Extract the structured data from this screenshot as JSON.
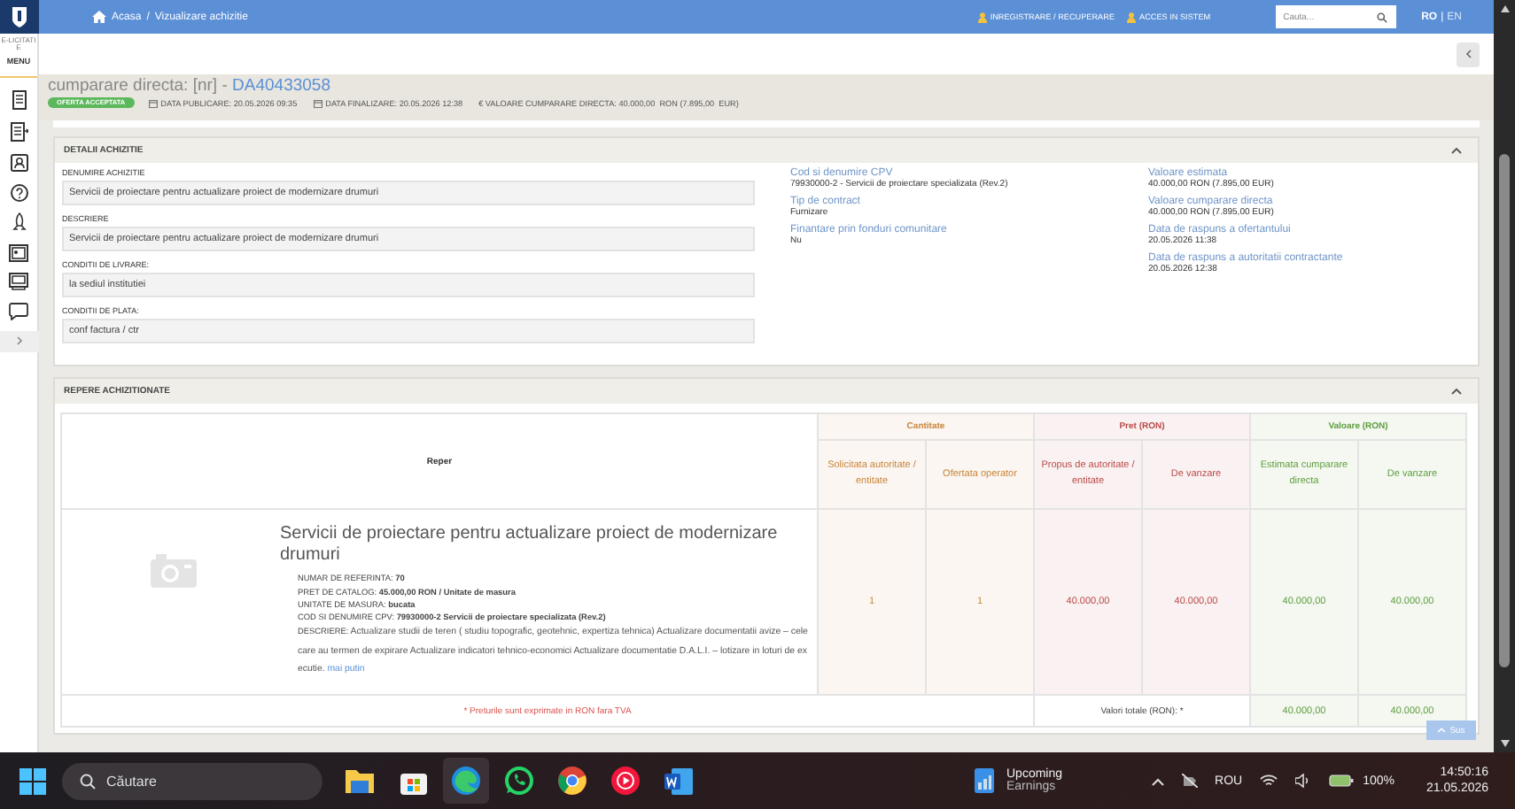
{
  "topbar": {
    "breadcrumb": [
      "Acasa",
      "Vizualizare achizitie"
    ],
    "breadcrumb_separator": "/",
    "links": [
      "INREGISTRARE / RECUPERARE",
      "ACCES IN SISTEM"
    ],
    "search": {
      "placeholder": "Cauta..."
    },
    "languages": [
      {
        "label": "RO",
        "selected": true
      },
      {
        "label": "EN",
        "selected": false
      }
    ],
    "language_separator": "|"
  },
  "sidebar": {
    "brand": "E-LICITATIE",
    "menu": "MENU"
  },
  "header": {
    "title": "cumparare directa: [nr] - ",
    "id": "DA40433058",
    "status": "OFERTA ACCEPTATA",
    "meta": [
      "DATA PUBLICARE: 20.05.2026 09:35",
      "DATA FINALIZARE: 20.05.2026 12:38",
      "€ VALOARE CUMPARARE DIRECTA: 40.000,00  RON (7.895,00  EUR)"
    ]
  },
  "details": {
    "title": "DETALII ACHIZITIE",
    "fields": [
      {
        "label": "DENUMIRE ACHIZITIE",
        "value": "Servicii de proiectare pentru actualizare proiect de modernizare drumuri"
      },
      {
        "label": "DESCRIERE",
        "value": "Servicii de proiectare pentru actualizare proiect de modernizare drumuri"
      },
      {
        "label": "CONDITII DE LIVRARE:",
        "value": "la sediul institutiei"
      },
      {
        "label": "CONDITII DE PLATA:",
        "value": "conf factura / ctr"
      }
    ],
    "info_middle": [
      {
        "label": "Cod si denumire CPV",
        "value": "79930000-2 - Servicii de proiectare specializata (Rev.2)"
      },
      {
        "label": "Tip de contract",
        "value": "Furnizare"
      },
      {
        "label": "Finantare prin fonduri comunitare",
        "value": "Nu"
      }
    ],
    "info_right": [
      {
        "label": "Valoare estimata",
        "value": "40.000,00  RON (7.895,00  EUR)"
      },
      {
        "label": "Valoare cumparare directa",
        "value": "40.000,00  RON (7.895,00  EUR)"
      },
      {
        "label": "Data de raspuns a ofertantului",
        "value": "20.05.2026 11:38"
      },
      {
        "label": "Data de raspuns a autoritatii contractante",
        "value": "20.05.2026 12:38"
      }
    ]
  },
  "items": {
    "title": "REPERE ACHIZITIONATE",
    "reper_header": "Reper",
    "groups": [
      {
        "title": "Cantitate",
        "color": "#c8853a",
        "columns": [
          "Solicitata autoritate / entitate",
          "Ofertata operator"
        ]
      },
      {
        "title": "Pret (RON)",
        "color": "#b94a48",
        "columns": [
          "Propus de autoritate / entitate",
          "De vanzare"
        ]
      },
      {
        "title": "Valoare (RON)",
        "color": "#5e9e3f",
        "columns": [
          "Estimata cumparare directa",
          "De vanzare"
        ]
      }
    ],
    "rows": [
      {
        "name": "Servicii de proiectare pentru actualizare proiect de modernizare drumuri",
        "details": [
          "NUMAR DE REFERINTA: **70**",
          "PRET DE CATALOG: **45.000,00  RON / Unitate de masura**",
          "UNITATE DE MASURA: **bucata**",
          "COD SI DENUMIRE CPV: **79930000-2 Servicii de proiectare specializata (Rev.2)**"
        ],
        "description_label": "DESCRIERE:",
        "description": "Actualizare studii de teren ( studiu topografic, geotehnic, expertiza tehnica) Actualizare documentatii avize – cele care au termen de expirare Actualizare indicatori tehnico-economici Actualizare documentatie D.A.L.I. – lotizare in loturi de executie.",
        "toggle": "mai putin",
        "cells": [
          "1",
          "1",
          "40.000,00",
          "40.000,00",
          "40.000,00",
          "40.000,00"
        ]
      }
    ],
    "note": "* Preturile sunt exprimate in RON fara TVA",
    "totals_label": "Valori totale (RON): *",
    "totals": [
      "40.000,00",
      "40.000,00"
    ]
  },
  "back_to_top": "Sus",
  "taskbar": {
    "search": {
      "placeholder": "Căutare"
    },
    "widget": [
      "Upcoming",
      "Earnings"
    ],
    "language": "ROU",
    "battery": "100%",
    "time": "14:50:16",
    "date": "21.05.2026"
  }
}
